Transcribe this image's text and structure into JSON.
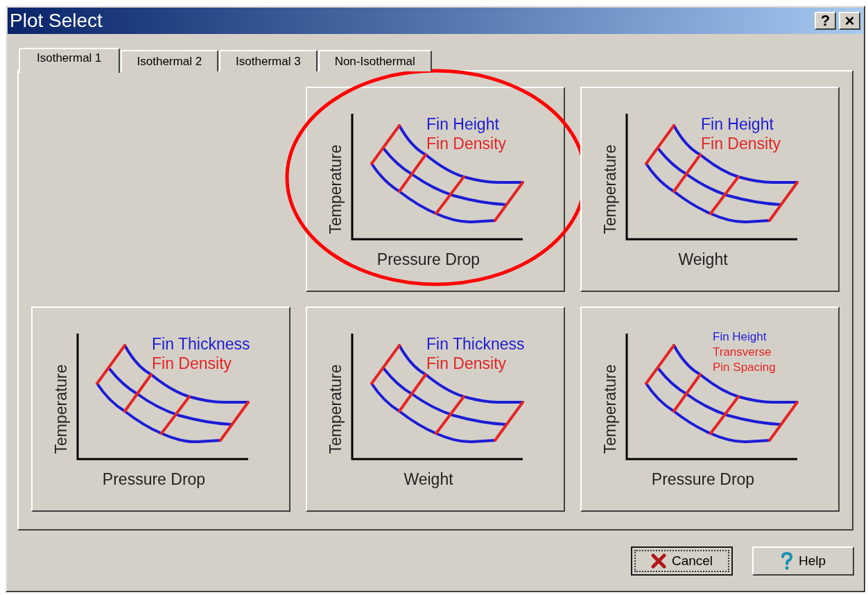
{
  "window": {
    "title": "Plot Select"
  },
  "title_buttons": [
    {
      "kind": "help",
      "label": "?"
    },
    {
      "kind": "close",
      "label": "×"
    }
  ],
  "tabs": [
    {
      "label": "Isothermal 1",
      "selected": true
    },
    {
      "label": "Isothermal 2",
      "selected": false
    },
    {
      "label": "Isothermal 3",
      "selected": false
    },
    {
      "label": "Non-Isothermal",
      "selected": false
    }
  ],
  "plots": [
    {
      "y_label": "Temperature",
      "x_label": "Pressure Drop",
      "circled": true,
      "compact": false,
      "legend": [
        {
          "text": "Fin Height",
          "color": "#1c1cd6"
        },
        {
          "text": "Fin Density",
          "color": "#e52424"
        }
      ]
    },
    {
      "y_label": "Temperature",
      "x_label": "Weight",
      "circled": false,
      "compact": false,
      "legend": [
        {
          "text": "Fin Height",
          "color": "#1c1cd6"
        },
        {
          "text": "Fin Density",
          "color": "#e52424"
        }
      ]
    },
    {
      "y_label": "Temperature",
      "x_label": "Pressure Drop",
      "circled": false,
      "compact": false,
      "legend": [
        {
          "text": "Fin Thickness",
          "color": "#1c1cd6"
        },
        {
          "text": "Fin Density",
          "color": "#e52424"
        }
      ]
    },
    {
      "y_label": "Temperature",
      "x_label": "Weight",
      "circled": false,
      "compact": false,
      "legend": [
        {
          "text": "Fin Thickness",
          "color": "#1c1cd6"
        },
        {
          "text": "Fin Density",
          "color": "#e52424"
        }
      ]
    },
    {
      "y_label": "Temperature",
      "x_label": "Pressure Drop",
      "circled": false,
      "compact": true,
      "legend": [
        {
          "text": "Fin Height",
          "color": "#1c1cd6"
        },
        {
          "text": "Transverse Pin Spacing",
          "color": "#e52424"
        }
      ]
    }
  ],
  "buttons": [
    {
      "kind": "cancel",
      "label": "Cancel",
      "focused": true
    },
    {
      "kind": "help",
      "label": "Help",
      "focused": false
    }
  ]
}
